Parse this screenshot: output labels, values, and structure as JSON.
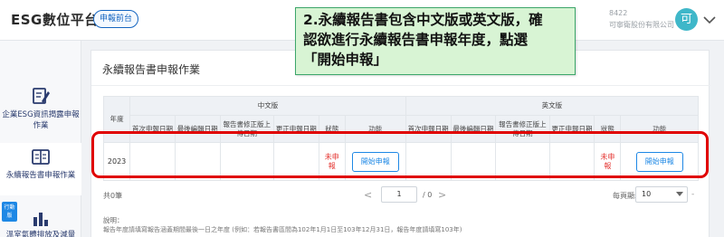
{
  "header": {
    "brand": "ESG數位平台",
    "front_label": "申報前台",
    "company_code": "8422",
    "company_name": "可寧衛股份有限公司",
    "avatar_initial": "可"
  },
  "sidebar": {
    "items": [
      {
        "label": "企業ESG資訊揭露申報作業",
        "icon": "edit-document-icon"
      },
      {
        "label": "永續報告書申報作業",
        "icon": "report-book-icon",
        "active": true
      },
      {
        "label": "溫室氣體排放及減量",
        "icon": "bar-chart-icon"
      }
    ],
    "badge": "行動版"
  },
  "main": {
    "card_title": "永續報告書申報作業",
    "table": {
      "year_header": "年度",
      "group_chinese": "中文版",
      "group_english": "英文版",
      "sub_headers": [
        "首次申報日期",
        "最後編輯日期",
        "報告書修正版上傳日期",
        "更正申報日期",
        "狀態",
        "功能"
      ],
      "rows": [
        {
          "year": "2023",
          "zh": {
            "first": "",
            "last_edit": "",
            "revised_upload": "",
            "corrected": "",
            "status": "未申報",
            "action": "開始申報"
          },
          "en": {
            "first": "",
            "last_edit": "",
            "revised_upload": "",
            "corrected": "",
            "status": "未申報",
            "action": "開始申報"
          }
        }
      ]
    },
    "pager": {
      "total": "共0筆",
      "prev": "<",
      "page": "1",
      "of_total": "/ 0",
      "next": ">",
      "per_page_label": "每頁顯示",
      "per_page_value": "10",
      "dash": "-"
    },
    "note_title": "說明：",
    "note_text": "報告年度請填寫報告涵蓋期間最後一日之年度 (例如：若報告書區間為102年1月1日至103年12月31日，報告年度請填寫103年)"
  },
  "callout": {
    "line1": "2.永續報告書包含中文版或英文版，確",
    "line2": "認欲進行永續報告書申報年度，點選",
    "line3": "「開始申報」"
  },
  "colors": {
    "accent": "#1e88e5",
    "status_red": "#e53935",
    "highlight": "#e00000",
    "callout_bg": "#d8f4d4",
    "avatar": "#3fb7c9"
  }
}
